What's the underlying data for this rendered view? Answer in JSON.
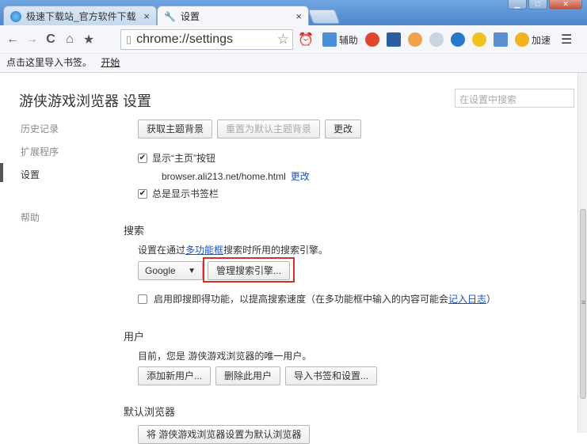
{
  "tabs": [
    {
      "label": "极速下载站_官方软件下载",
      "close": "×"
    },
    {
      "label": "设置",
      "close": "×"
    }
  ],
  "address": {
    "url": "chrome://settings"
  },
  "extensions": {
    "assist_label": "辅助",
    "speedup_label": "加速"
  },
  "bookmarks_bar": {
    "prompt": "点击这里导入书签。",
    "start_link": "开始"
  },
  "settings": {
    "title": "游侠游戏浏览器 设置",
    "search_placeholder": "在设置中搜索",
    "nav": [
      {
        "label": "历史记录"
      },
      {
        "label": "扩展程序"
      },
      {
        "label": "设置"
      },
      {
        "label": "帮助"
      }
    ],
    "appearance": {
      "get_theme": "获取主题背景",
      "reset_theme": "重置为默认主题背景",
      "change": "更改",
      "show_home_label": "显示“主页”按钮",
      "home_url": "browser.ali213.net/home.html",
      "home_change": "更改",
      "always_bookmarks": "总是显示书签栏"
    },
    "search": {
      "title": "搜索",
      "desc_prefix": "设置在通过",
      "desc_link": "多功能框",
      "desc_suffix": "搜索时所用的搜索引擎。",
      "engine": "Google",
      "manage": "管理搜索引擎...",
      "instant_prefix": "启用即搜即得功能，以提高搜索速度（在多功能框中输入的内容可能会",
      "instant_link": "记入日志",
      "instant_suffix": "）"
    },
    "users": {
      "title": "用户",
      "desc": "目前，您是 游侠游戏浏览器的唯一用户。",
      "add": "添加新用户...",
      "delete": "删除此用户",
      "import": "导入书签和设置..."
    },
    "default_browser": {
      "title": "默认浏览器",
      "button": "将 游侠游戏浏览器设置为默认浏览器"
    }
  }
}
